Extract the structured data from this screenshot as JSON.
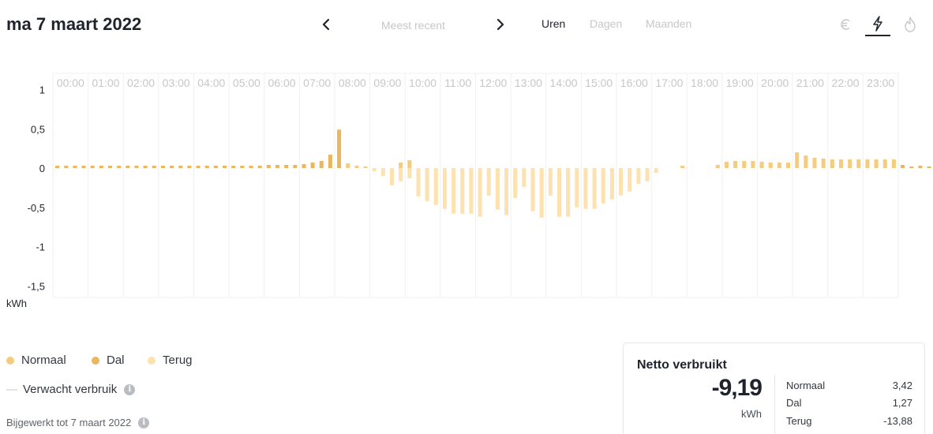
{
  "header": {
    "date_title": "ma 7 maart 2022",
    "recent_label": "Meest recent",
    "tabs": [
      {
        "label": "Uren",
        "active": true
      },
      {
        "label": "Dagen",
        "active": false
      },
      {
        "label": "Maanden",
        "active": false
      }
    ],
    "energy_icons": [
      "euro-icon",
      "lightning-icon",
      "flame-icon"
    ],
    "selected_energy": "lightning-icon"
  },
  "colors": {
    "normaal": "#f5cb7e",
    "dal": "#ebb65c",
    "terug": "#fde1ae",
    "expected": "#e2e4e7",
    "text_dark": "#1f232b",
    "text_muted": "#c5c7ca"
  },
  "chart_data": {
    "type": "bar",
    "unit": "kWh",
    "x": [
      "00:00",
      "01:00",
      "02:00",
      "03:00",
      "04:00",
      "05:00",
      "06:00",
      "07:00",
      "08:00",
      "09:00",
      "10:00",
      "11:00",
      "12:00",
      "13:00",
      "14:00",
      "15:00",
      "16:00",
      "17:00",
      "18:00",
      "19:00",
      "20:00",
      "21:00",
      "22:00",
      "23:00"
    ],
    "bars_per_hour": 4,
    "ylim": [
      -1.6,
      1.2
    ],
    "yticks": [
      1,
      0.5,
      0,
      -0.5,
      -1,
      -1.5
    ],
    "ytick_labels": [
      "1",
      "0,5",
      "0",
      "-0,5",
      "-1",
      "-1,5"
    ],
    "grid": {
      "vertical": true,
      "horizontal": false
    },
    "series": [
      {
        "name": "Dal",
        "values": [
          0.03,
          0.03,
          0.03,
          0.03,
          0.03,
          0.03,
          0.03,
          0.03,
          0.03,
          0.03,
          0.03,
          0.03,
          0.03,
          0.03,
          0.03,
          0.03,
          0.03,
          0.03,
          0.03,
          0.03,
          0.03,
          0.03,
          0.03,
          0.03,
          0.04,
          0.04,
          0.04,
          0.04,
          0.05,
          0.07,
          0.09,
          0.17,
          0.49,
          0,
          0,
          0,
          0,
          0,
          0,
          0,
          0,
          0,
          0,
          0,
          0,
          0,
          0,
          0,
          0,
          0,
          0,
          0,
          0,
          0,
          0,
          0,
          0,
          0,
          0,
          0,
          0,
          0,
          0,
          0,
          0,
          0,
          0,
          0,
          0,
          0,
          0,
          0,
          0,
          0,
          0,
          0,
          0,
          0,
          0,
          0,
          0,
          0,
          0,
          0,
          0,
          0,
          0,
          0,
          0,
          0,
          0,
          0,
          0,
          0,
          0,
          0,
          0.04,
          0.02,
          0.03,
          0.02,
          0.03,
          0.02,
          0.03,
          0.03
        ]
      },
      {
        "name": "Normaal",
        "values": [
          0,
          0,
          0,
          0,
          0,
          0,
          0,
          0,
          0,
          0,
          0,
          0,
          0,
          0,
          0,
          0,
          0,
          0,
          0,
          0,
          0,
          0,
          0,
          0,
          0,
          0,
          0,
          0,
          0,
          0,
          0,
          0,
          0,
          0.06,
          0.03,
          0.02,
          0,
          0,
          0,
          0.07,
          0.1,
          0,
          0,
          0,
          0,
          0,
          0,
          0,
          0,
          0,
          0,
          0,
          0,
          0,
          0,
          0,
          0,
          0,
          0,
          0,
          0,
          0,
          0,
          0,
          0,
          0,
          0,
          0,
          0,
          0,
          0,
          0.03,
          0,
          0,
          0,
          0.04,
          0.08,
          0.09,
          0.09,
          0.09,
          0.08,
          0.07,
          0.07,
          0.07,
          0.2,
          0.16,
          0.13,
          0.12,
          0.11,
          0.11,
          0.11,
          0.11,
          0.11,
          0.11,
          0.11,
          0.11,
          0,
          0,
          0,
          0,
          0,
          0,
          0,
          0
        ]
      },
      {
        "name": "Terug",
        "values": [
          0,
          0,
          0,
          0,
          0,
          0,
          0,
          0,
          0,
          0,
          0,
          0,
          0,
          0,
          0,
          0,
          0,
          0,
          0,
          0,
          0,
          0,
          0,
          0,
          0,
          0,
          0,
          0,
          0,
          0,
          0,
          0,
          0,
          0,
          0,
          0,
          -0.04,
          -0.1,
          -0.22,
          -0.17,
          -0.13,
          -0.36,
          -0.42,
          -0.47,
          -0.52,
          -0.58,
          -0.58,
          -0.58,
          -0.62,
          -0.35,
          -0.53,
          -0.6,
          -0.38,
          -0.24,
          -0.55,
          -0.63,
          -0.35,
          -0.62,
          -0.62,
          -0.5,
          -0.52,
          -0.52,
          -0.45,
          -0.4,
          -0.35,
          -0.3,
          -0.2,
          -0.17,
          -0.06,
          0,
          0,
          0,
          0,
          0,
          0,
          0,
          0,
          0,
          0,
          0,
          0,
          0,
          0,
          0,
          0,
          0,
          0,
          0,
          0,
          0,
          0,
          0,
          0,
          0,
          0,
          0,
          0,
          0,
          0,
          0
        ]
      }
    ]
  },
  "legend": {
    "normaal": "Normaal",
    "dal": "Dal",
    "terug": "Terug",
    "expected": "Verwacht verbruik"
  },
  "footer": {
    "updated": "Bijgewerkt tot 7 maart 2022"
  },
  "netto": {
    "title": "Netto verbruikt",
    "value": "-9,19",
    "unit": "kWh",
    "breakdown": [
      {
        "label": "Normaal",
        "value": "3,42"
      },
      {
        "label": "Dal",
        "value": "1,27"
      },
      {
        "label": "Terug",
        "value": "-13,88"
      }
    ]
  }
}
